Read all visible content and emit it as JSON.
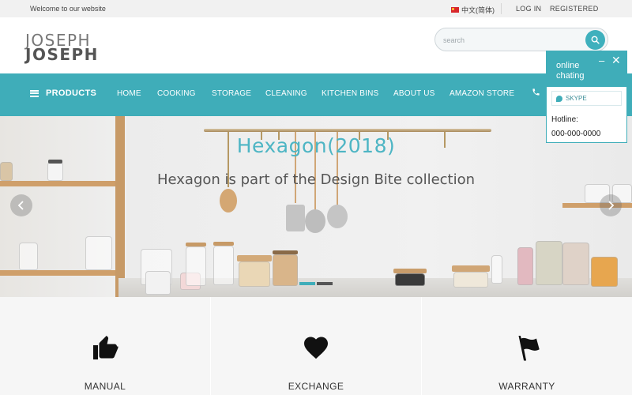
{
  "topbar": {
    "welcome": "Welcome to our website",
    "language": "中文(简体)",
    "login": "LOG IN",
    "register": "REGISTERED"
  },
  "header": {
    "logo_line1": "JOSEPH",
    "logo_line2": "JOSEPH",
    "search_placeholder": "search"
  },
  "nav": {
    "products": "PRODUCTS",
    "items": [
      "HOME",
      "COOKING",
      "STORAGE",
      "CLEANING",
      "KITCHEN BINS",
      "ABOUT US",
      "AMAZON STORE"
    ]
  },
  "hero": {
    "title": "Hexagon(2018)",
    "subtitle": "Hexagon is part of the Design Bite collection",
    "slides_total": 2,
    "slide_active": 1
  },
  "features": [
    {
      "label": "MANUAL",
      "icon": "thumbs-up-icon"
    },
    {
      "label": "EXCHANGE",
      "icon": "heart-icon"
    },
    {
      "label": "WARRANTY",
      "icon": "flag-icon"
    }
  ],
  "chat": {
    "title": "online chating",
    "skype": "SKYPE",
    "hotline_label": "Hotline:",
    "hotline_number": "000-000-0000"
  },
  "colors": {
    "accent": "#3fadb9",
    "hero_title": "#4db5c4",
    "topbar_bg": "#f1f1f1",
    "feature_bg": "#f6f6f6"
  }
}
